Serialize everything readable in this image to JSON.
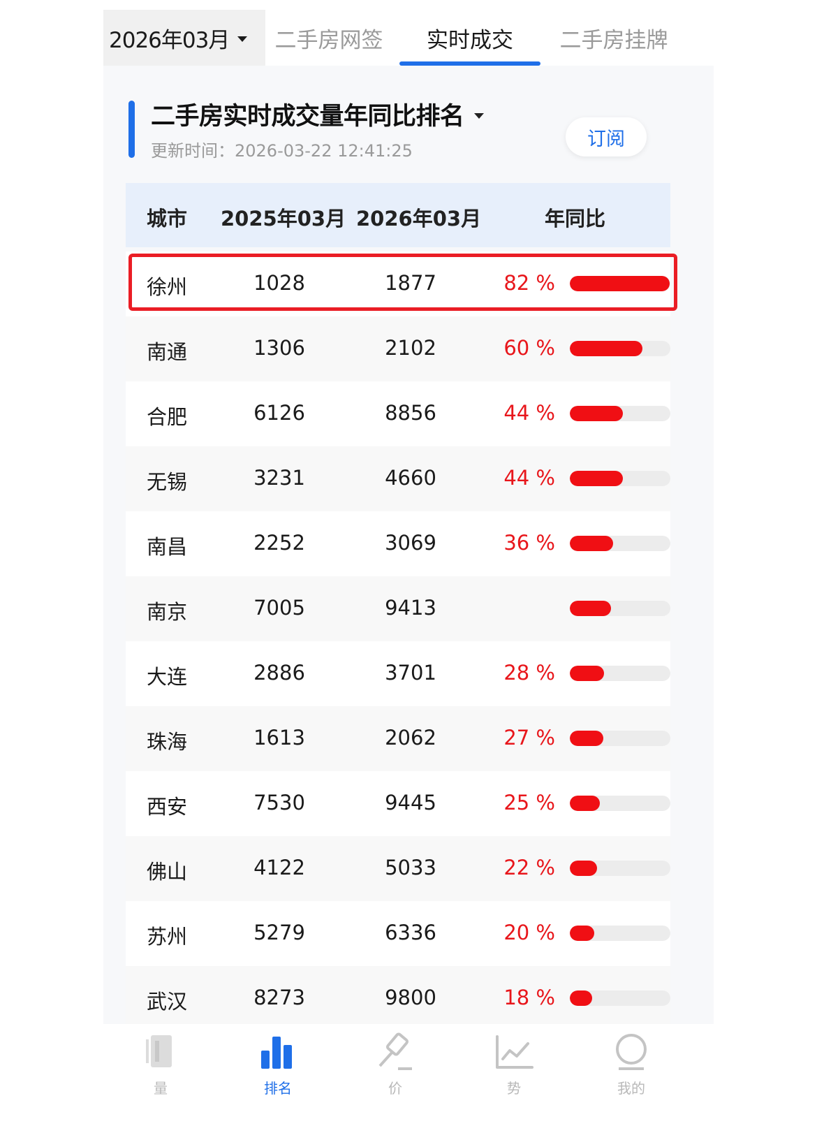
{
  "tabs": {
    "month": "2026年03月",
    "items": [
      {
        "label": "二手房网签",
        "active": false
      },
      {
        "label": "实时成交",
        "active": true
      },
      {
        "label": "二手房挂牌",
        "active": false
      }
    ]
  },
  "header": {
    "title": "二手房实时成交量年同比排名",
    "update_time": "更新时间：2026-03-22 12:41:25",
    "subscribe": "订阅"
  },
  "table": {
    "columns": [
      "城市",
      "2025年03月",
      "2026年03月",
      "年同比"
    ],
    "rows": [
      {
        "city": "徐州",
        "prev": "1028",
        "curr": "1877",
        "pct": "82 %",
        "ratio": 0.82
      },
      {
        "city": "南通",
        "prev": "1306",
        "curr": "2102",
        "pct": "60 %",
        "ratio": 0.6
      },
      {
        "city": "合肥",
        "prev": "6126",
        "curr": "8856",
        "pct": "44 %",
        "ratio": 0.44
      },
      {
        "city": "无锡",
        "prev": "3231",
        "curr": "4660",
        "pct": "44 %",
        "ratio": 0.44
      },
      {
        "city": "南昌",
        "prev": "2252",
        "curr": "3069",
        "pct": "36 %",
        "ratio": 0.36
      },
      {
        "city": "南京",
        "prev": "7005",
        "curr": "9413",
        "pct": "",
        "ratio": 0.34
      },
      {
        "city": "大连",
        "prev": "2886",
        "curr": "3701",
        "pct": "28 %",
        "ratio": 0.28
      },
      {
        "city": "珠海",
        "prev": "1613",
        "curr": "2062",
        "pct": "27 %",
        "ratio": 0.27
      },
      {
        "city": "西安",
        "prev": "7530",
        "curr": "9445",
        "pct": "25 %",
        "ratio": 0.25
      },
      {
        "city": "佛山",
        "prev": "4122",
        "curr": "5033",
        "pct": "22 %",
        "ratio": 0.22
      },
      {
        "city": "苏州",
        "prev": "5279",
        "curr": "6336",
        "pct": "20 %",
        "ratio": 0.2
      },
      {
        "city": "武汉",
        "prev": "8273",
        "curr": "9800",
        "pct": "18 %",
        "ratio": 0.18
      }
    ]
  },
  "bottom_nav": [
    {
      "label": "量",
      "icon": "document-icon",
      "active": false
    },
    {
      "label": "排名",
      "icon": "bar-chart-icon",
      "active": true
    },
    {
      "label": "价",
      "icon": "gavel-icon",
      "active": false
    },
    {
      "label": "势",
      "icon": "trend-line-icon",
      "active": false
    },
    {
      "label": "我的",
      "icon": "profile-icon",
      "active": false
    }
  ],
  "colors": {
    "accent": "#1f6fe8",
    "increase": "#e8161b",
    "highlight_border": "#ea1d25"
  }
}
